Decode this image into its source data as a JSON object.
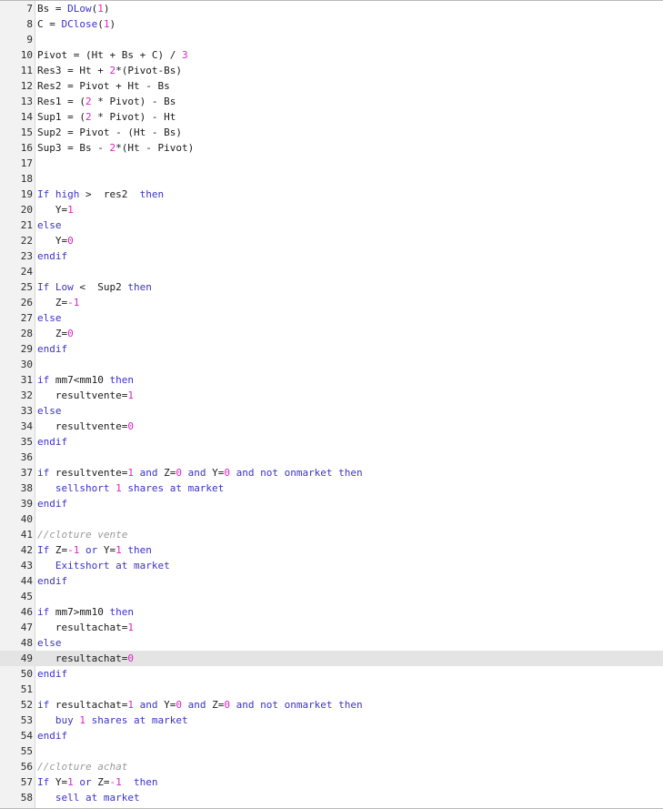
{
  "colors": {
    "keyword": "#3a32c8",
    "number": "#e020c8",
    "comment": "#9a9a9a",
    "identifier": "#1a1a1a",
    "highlight_line_bg": "#e4e4e4",
    "gutter_bg": "#f2f2f2"
  },
  "highlighted_line": 49,
  "lines": [
    {
      "n": "7",
      "tokens": [
        {
          "t": "Bs = ",
          "c": "id"
        },
        {
          "t": "DLow",
          "c": "kw"
        },
        {
          "t": "(",
          "c": "id"
        },
        {
          "t": "1",
          "c": "num"
        },
        {
          "t": ")",
          "c": "id"
        }
      ]
    },
    {
      "n": "8",
      "tokens": [
        {
          "t": "C = ",
          "c": "id"
        },
        {
          "t": "DClose",
          "c": "kw"
        },
        {
          "t": "(",
          "c": "id"
        },
        {
          "t": "1",
          "c": "num"
        },
        {
          "t": ")",
          "c": "id"
        }
      ]
    },
    {
      "n": "9",
      "tokens": []
    },
    {
      "n": "10",
      "tokens": [
        {
          "t": "Pivot = (Ht + Bs + C) / ",
          "c": "id"
        },
        {
          "t": "3",
          "c": "num"
        }
      ]
    },
    {
      "n": "11",
      "tokens": [
        {
          "t": "Res3 = Ht + ",
          "c": "id"
        },
        {
          "t": "2",
          "c": "num"
        },
        {
          "t": "*(Pivot-Bs)",
          "c": "id"
        }
      ]
    },
    {
      "n": "12",
      "tokens": [
        {
          "t": "Res2 = Pivot + Ht - Bs",
          "c": "id"
        }
      ]
    },
    {
      "n": "13",
      "tokens": [
        {
          "t": "Res1 = (",
          "c": "id"
        },
        {
          "t": "2",
          "c": "num"
        },
        {
          "t": " * Pivot) - Bs",
          "c": "id"
        }
      ]
    },
    {
      "n": "14",
      "tokens": [
        {
          "t": "Sup1 = (",
          "c": "id"
        },
        {
          "t": "2",
          "c": "num"
        },
        {
          "t": " * Pivot) - Ht",
          "c": "id"
        }
      ]
    },
    {
      "n": "15",
      "tokens": [
        {
          "t": "Sup2 = Pivot - (Ht - Bs)",
          "c": "id"
        }
      ]
    },
    {
      "n": "16",
      "tokens": [
        {
          "t": "Sup3 = Bs - ",
          "c": "id"
        },
        {
          "t": "2",
          "c": "num"
        },
        {
          "t": "*(Ht - Pivot)",
          "c": "id"
        }
      ]
    },
    {
      "n": "17",
      "tokens": []
    },
    {
      "n": "18",
      "tokens": []
    },
    {
      "n": "19",
      "tokens": [
        {
          "t": "If high",
          "c": "kw"
        },
        {
          "t": " >  res2  ",
          "c": "id"
        },
        {
          "t": "then",
          "c": "kw"
        }
      ]
    },
    {
      "n": "20",
      "tokens": [
        {
          "t": "   Y=",
          "c": "id"
        },
        {
          "t": "1",
          "c": "num"
        }
      ]
    },
    {
      "n": "21",
      "tokens": [
        {
          "t": "else",
          "c": "kw"
        }
      ]
    },
    {
      "n": "22",
      "tokens": [
        {
          "t": "   Y=",
          "c": "id"
        },
        {
          "t": "0",
          "c": "num"
        }
      ]
    },
    {
      "n": "23",
      "tokens": [
        {
          "t": "endif",
          "c": "kw"
        }
      ]
    },
    {
      "n": "24",
      "tokens": []
    },
    {
      "n": "25",
      "tokens": [
        {
          "t": "If Low",
          "c": "kw"
        },
        {
          "t": " <  Sup2 ",
          "c": "id"
        },
        {
          "t": "then",
          "c": "kw"
        }
      ]
    },
    {
      "n": "26",
      "tokens": [
        {
          "t": "   Z=",
          "c": "id"
        },
        {
          "t": "-1",
          "c": "num"
        }
      ]
    },
    {
      "n": "27",
      "tokens": [
        {
          "t": "else",
          "c": "kw"
        }
      ]
    },
    {
      "n": "28",
      "tokens": [
        {
          "t": "   Z=",
          "c": "id"
        },
        {
          "t": "0",
          "c": "num"
        }
      ]
    },
    {
      "n": "29",
      "tokens": [
        {
          "t": "endif",
          "c": "kw"
        }
      ]
    },
    {
      "n": "30",
      "tokens": []
    },
    {
      "n": "31",
      "tokens": [
        {
          "t": "if",
          "c": "kw"
        },
        {
          "t": " mm7<mm10 ",
          "c": "id"
        },
        {
          "t": "then",
          "c": "kw"
        }
      ]
    },
    {
      "n": "32",
      "tokens": [
        {
          "t": "   resultvente=",
          "c": "id"
        },
        {
          "t": "1",
          "c": "num"
        }
      ]
    },
    {
      "n": "33",
      "tokens": [
        {
          "t": "else",
          "c": "kw"
        }
      ]
    },
    {
      "n": "34",
      "tokens": [
        {
          "t": "   resultvente=",
          "c": "id"
        },
        {
          "t": "0",
          "c": "num"
        }
      ]
    },
    {
      "n": "35",
      "tokens": [
        {
          "t": "endif",
          "c": "kw"
        }
      ]
    },
    {
      "n": "36",
      "tokens": []
    },
    {
      "n": "37",
      "tokens": [
        {
          "t": "if",
          "c": "kw"
        },
        {
          "t": " resultvente=",
          "c": "id"
        },
        {
          "t": "1",
          "c": "num"
        },
        {
          "t": " ",
          "c": "id"
        },
        {
          "t": "and",
          "c": "kw"
        },
        {
          "t": " Z=",
          "c": "id"
        },
        {
          "t": "0",
          "c": "num"
        },
        {
          "t": " ",
          "c": "id"
        },
        {
          "t": "and",
          "c": "kw"
        },
        {
          "t": " Y=",
          "c": "id"
        },
        {
          "t": "0",
          "c": "num"
        },
        {
          "t": " ",
          "c": "id"
        },
        {
          "t": "and not onmarket then",
          "c": "kw"
        }
      ]
    },
    {
      "n": "38",
      "tokens": [
        {
          "t": "   sellshort ",
          "c": "kw"
        },
        {
          "t": "1",
          "c": "num"
        },
        {
          "t": " shares at market",
          "c": "kw"
        }
      ]
    },
    {
      "n": "39",
      "tokens": [
        {
          "t": "endif",
          "c": "kw"
        }
      ]
    },
    {
      "n": "40",
      "tokens": []
    },
    {
      "n": "41",
      "tokens": [
        {
          "t": "//cloture vente",
          "c": "cm"
        }
      ]
    },
    {
      "n": "42",
      "tokens": [
        {
          "t": "If",
          "c": "kw"
        },
        {
          "t": " Z=",
          "c": "id"
        },
        {
          "t": "-1",
          "c": "num"
        },
        {
          "t": " ",
          "c": "id"
        },
        {
          "t": "or",
          "c": "kw"
        },
        {
          "t": " Y=",
          "c": "id"
        },
        {
          "t": "1",
          "c": "num"
        },
        {
          "t": " ",
          "c": "id"
        },
        {
          "t": "then",
          "c": "kw"
        }
      ]
    },
    {
      "n": "43",
      "tokens": [
        {
          "t": "   Exitshort at market",
          "c": "kw"
        }
      ]
    },
    {
      "n": "44",
      "tokens": [
        {
          "t": "endif",
          "c": "kw"
        }
      ]
    },
    {
      "n": "45",
      "tokens": []
    },
    {
      "n": "46",
      "tokens": [
        {
          "t": "if",
          "c": "kw"
        },
        {
          "t": " mm7>mm10 ",
          "c": "id"
        },
        {
          "t": "then",
          "c": "kw"
        }
      ]
    },
    {
      "n": "47",
      "tokens": [
        {
          "t": "   resultachat=",
          "c": "id"
        },
        {
          "t": "1",
          "c": "num"
        }
      ]
    },
    {
      "n": "48",
      "tokens": [
        {
          "t": "else",
          "c": "kw"
        }
      ]
    },
    {
      "n": "49",
      "tokens": [
        {
          "t": "   resultachat=",
          "c": "id"
        },
        {
          "t": "0",
          "c": "num"
        }
      ]
    },
    {
      "n": "50",
      "tokens": [
        {
          "t": "endif",
          "c": "kw"
        }
      ]
    },
    {
      "n": "51",
      "tokens": []
    },
    {
      "n": "52",
      "tokens": [
        {
          "t": "if",
          "c": "kw"
        },
        {
          "t": " resultachat=",
          "c": "id"
        },
        {
          "t": "1",
          "c": "num"
        },
        {
          "t": " ",
          "c": "id"
        },
        {
          "t": "and",
          "c": "kw"
        },
        {
          "t": " Y=",
          "c": "id"
        },
        {
          "t": "0",
          "c": "num"
        },
        {
          "t": " ",
          "c": "id"
        },
        {
          "t": "and",
          "c": "kw"
        },
        {
          "t": " Z=",
          "c": "id"
        },
        {
          "t": "0",
          "c": "num"
        },
        {
          "t": " ",
          "c": "id"
        },
        {
          "t": "and not onmarket then",
          "c": "kw"
        }
      ]
    },
    {
      "n": "53",
      "tokens": [
        {
          "t": "   buy ",
          "c": "kw"
        },
        {
          "t": "1",
          "c": "num"
        },
        {
          "t": " shares at market",
          "c": "kw"
        }
      ]
    },
    {
      "n": "54",
      "tokens": [
        {
          "t": "endif",
          "c": "kw"
        }
      ]
    },
    {
      "n": "55",
      "tokens": []
    },
    {
      "n": "56",
      "tokens": [
        {
          "t": "//cloture achat",
          "c": "cm"
        }
      ]
    },
    {
      "n": "57",
      "tokens": [
        {
          "t": "If",
          "c": "kw"
        },
        {
          "t": " Y=",
          "c": "id"
        },
        {
          "t": "1",
          "c": "num"
        },
        {
          "t": " ",
          "c": "id"
        },
        {
          "t": "or",
          "c": "kw"
        },
        {
          "t": " Z=",
          "c": "id"
        },
        {
          "t": "-1",
          "c": "num"
        },
        {
          "t": "  ",
          "c": "id"
        },
        {
          "t": "then",
          "c": "kw"
        }
      ]
    },
    {
      "n": "58",
      "tokens": [
        {
          "t": "   sell at market",
          "c": "kw"
        }
      ]
    }
  ]
}
